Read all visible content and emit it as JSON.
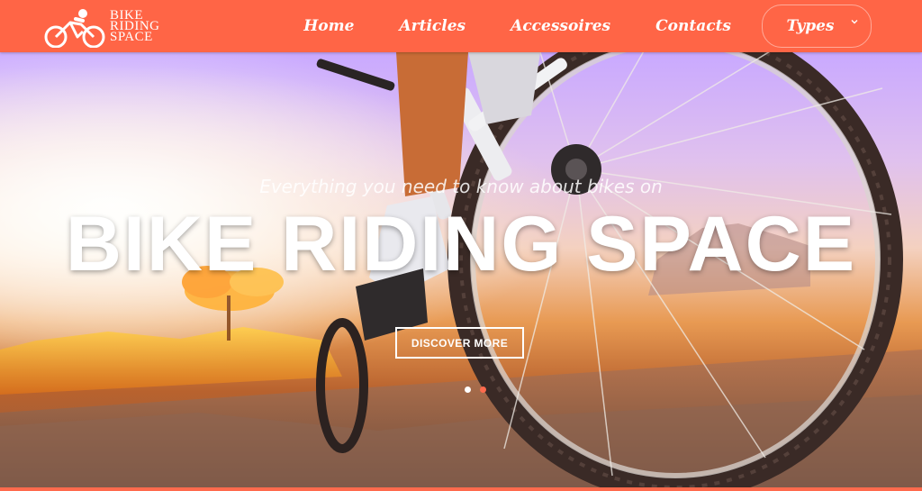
{
  "brand": {
    "line1": "BIKE",
    "line2": "RIDING",
    "line3": "SPACE",
    "logo_icon": "cyclist-icon"
  },
  "nav": {
    "items": [
      {
        "label": "Home"
      },
      {
        "label": "Articles"
      },
      {
        "label": "Accessoires"
      },
      {
        "label": "Contacts"
      },
      {
        "label": "Types"
      }
    ],
    "dropdown_icon": "chevron-down-icon"
  },
  "hero": {
    "subtitle": "Everything you need to know about bikes on",
    "title": "BIKE RIDING SPACE",
    "cta_label": "DISCOVER MORE"
  },
  "slider": {
    "slide_count": 2,
    "active_index": 0
  },
  "colors": {
    "brand": "#ff6546",
    "white": "#ffffff",
    "dot_inactive": "#ff6a4d"
  }
}
